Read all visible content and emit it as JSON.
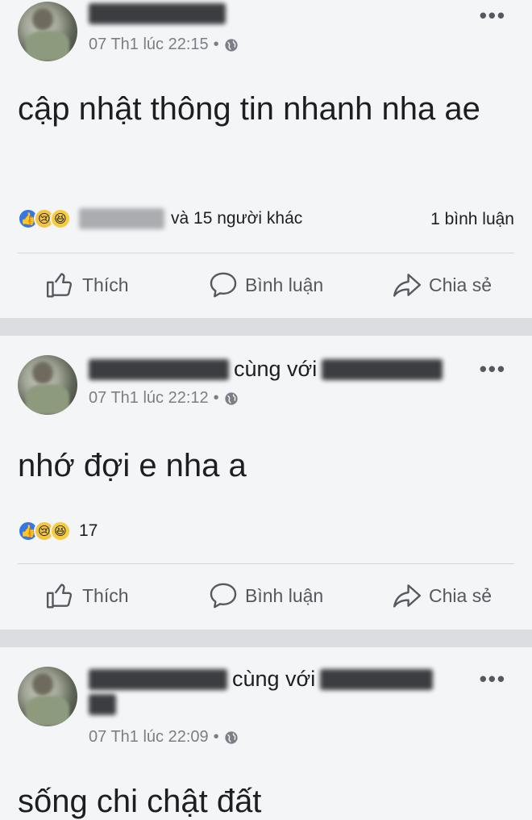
{
  "posts": [
    {
      "author_suffix": "",
      "with_label": "",
      "time": "07 Th1 lúc 22:15",
      "separator": "•",
      "text": "cập nhật thông tin nhanh nha ae",
      "reactions_text": "và 15 người khác",
      "comments": "1 bình luận",
      "actions": {
        "like": "Thích",
        "comment": "Bình luận",
        "share": "Chia sẻ"
      }
    },
    {
      "with_label": "cùng với",
      "time": "07 Th1 lúc 22:12",
      "separator": "•",
      "text": "nhớ đợi e nha a",
      "reactions_count": "17",
      "actions": {
        "like": "Thích",
        "comment": "Bình luận",
        "share": "Chia sẻ"
      }
    },
    {
      "with_label": "cùng với",
      "time": "07 Th1 lúc 22:09",
      "separator": "•",
      "text": "sống chi chật đất"
    }
  ],
  "more_glyph": "•••",
  "icons": [
    "globe-icon",
    "like-icon",
    "comment-icon",
    "share-icon",
    "more-icon",
    "reaction-like-icon",
    "reaction-sad-icon",
    "reaction-haha-icon"
  ],
  "colors": {
    "background": "#f4f5f7",
    "separator": "#dcdde0",
    "like_blue": "#3578e5",
    "muted": "#7b7e84"
  }
}
